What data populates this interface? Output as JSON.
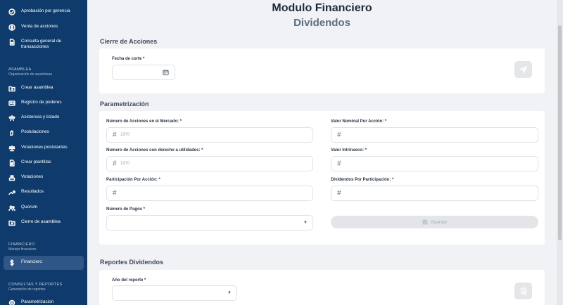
{
  "sidebar": {
    "top_items": [
      {
        "label": "Aprobación por gerencia",
        "icon": "check-circle-icon"
      },
      {
        "label": "Venta de acciones",
        "icon": "dollar-circle-icon"
      },
      {
        "label": "Consulta general de transacciones",
        "icon": "document-icon"
      }
    ],
    "asamblea": {
      "title": "ASAMBLEA",
      "subtitle": "Organización de asambleas",
      "items": [
        {
          "label": "Crear asamblea",
          "icon": "folder-icon"
        },
        {
          "label": "Registro de poderes",
          "icon": "id-card-icon"
        },
        {
          "label": "Asistencia y listado",
          "icon": "group-icon"
        },
        {
          "label": "Postulaciones",
          "icon": "hand-icon"
        },
        {
          "label": "Votaciones postulantes",
          "icon": "scale-icon"
        },
        {
          "label": "Crear plantillas",
          "icon": "template-icon"
        },
        {
          "label": "Votaciones",
          "icon": "ballot-icon"
        },
        {
          "label": "Resultados",
          "icon": "trend-icon"
        },
        {
          "label": "Quorum",
          "icon": "people-icon"
        },
        {
          "label": "Cierre de asamblea",
          "icon": "folder-close-icon"
        }
      ]
    },
    "financiero": {
      "title": "FINANCIERO",
      "subtitle": "Manejo financiero",
      "items": [
        {
          "label": "Financiero",
          "icon": "dollar-icon",
          "active": true
        }
      ]
    },
    "consultas": {
      "title": "CONSULTAS Y REPORTES",
      "subtitle": "Generación de reportes",
      "items": [
        {
          "label": "Parametrizacion",
          "icon": "settings-icon"
        }
      ]
    }
  },
  "header": {
    "title": "Modulo Financiero",
    "subtitle": "Dividendos"
  },
  "cierre": {
    "heading": "Cierre de Acciones",
    "fecha_label": "Fecha de corte *",
    "fecha_value": "",
    "send_icon": "send-icon"
  },
  "param": {
    "heading": "Parametrización",
    "acciones_mercado_label": "Número de Acciones en el Mercado: *",
    "acciones_mercado_placeholder": "1970",
    "valor_nominal_label": "Valor Nominal Por Acción: *",
    "acciones_derecho_label": "Número de Acciones con derecho a utilidades: *",
    "acciones_derecho_placeholder": "1970",
    "valor_intrinseco_label": "Valor Intrínseco: *",
    "participacion_label": "Participación Por Acción: *",
    "dividendos_label": "Dividendos Por Participación: *",
    "pagos_label": "Número de Pagos *",
    "save_label": "Guardar"
  },
  "reportes": {
    "heading": "Reportes Dividendos",
    "anio_label": "Año del reporte *"
  },
  "colors": {
    "sidebar": "#0f3b6c",
    "sidebar_active": "#2f5686",
    "background": "#f1f2f5"
  }
}
